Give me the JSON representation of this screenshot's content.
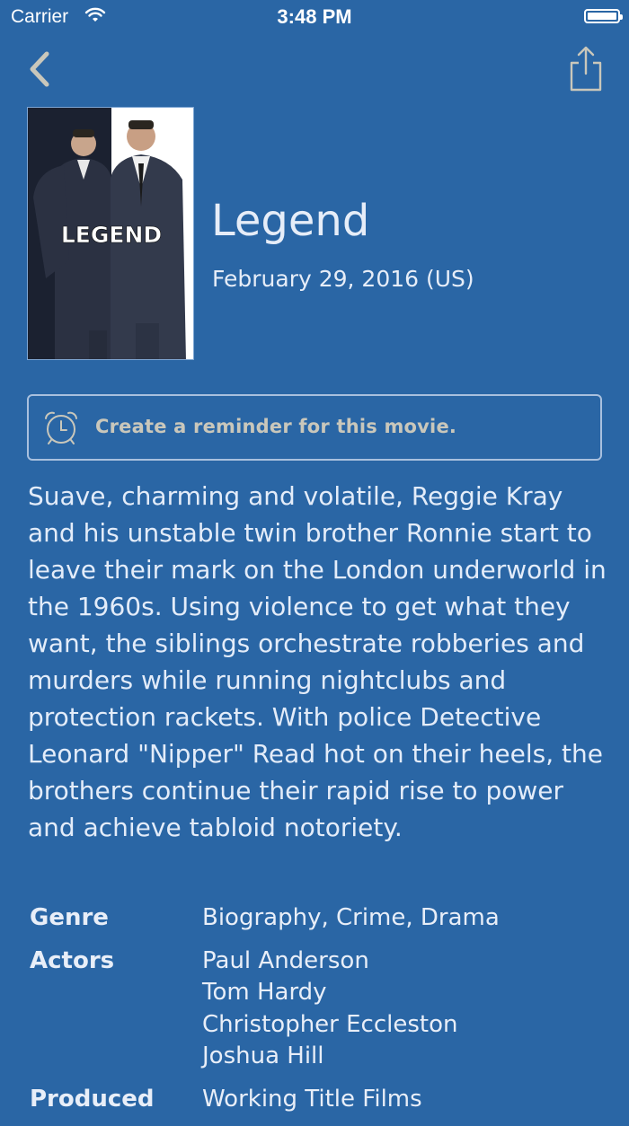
{
  "status_bar": {
    "carrier": "Carrier",
    "time": "3:48 PM"
  },
  "nav": {
    "back_icon": "chevron-left-icon",
    "share_icon": "share-icon"
  },
  "movie": {
    "poster_title": "LEGEND",
    "title": "Legend",
    "release_date": "February 29, 2016 (US)"
  },
  "reminder": {
    "icon": "alarm-clock-icon",
    "label": "Create a reminder for this movie."
  },
  "overview": "Suave, charming and volatile, Reggie Kray and his unstable twin brother Ronnie start to leave their mark on the London underworld in the 1960s. Using violence to get what they want, the siblings orchestrate robberies and murders while running nightclubs and protection rackets. With police Detective Leonard \"Nipper\" Read hot on their heels, the brothers continue their rapid rise to power and achieve tabloid notoriety.",
  "details": {
    "genre": {
      "label": "Genre",
      "value": "Biography, Crime, Drama"
    },
    "actors": {
      "label": "Actors",
      "values": [
        "Paul Anderson",
        "Tom Hardy",
        "Christopher Eccleston",
        "Joshua Hill"
      ]
    },
    "produced": {
      "label": "Produced",
      "value": "Working Title Films"
    }
  },
  "colors": {
    "background": "#2a66a5",
    "accent": "#c9c7bb",
    "text": "#e6edf8"
  }
}
